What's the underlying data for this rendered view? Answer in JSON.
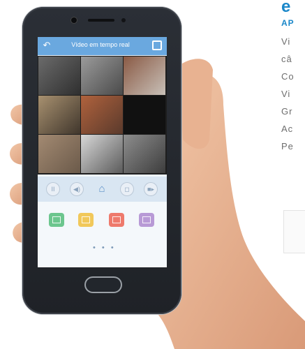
{
  "side_text": {
    "heading": "e",
    "subheading": "AP",
    "lines": [
      "Vi",
      "câ",
      "Co",
      "Vi",
      "Gr",
      "Ac",
      "Pe"
    ]
  },
  "app": {
    "title": "Vídeo em tempo real",
    "back_icon": "back-arrow-icon",
    "fullscreen_icon": "fullscreen-icon",
    "pager_dots": "• • •"
  },
  "controls": [
    {
      "name": "pause-icon",
      "glyph": "II"
    },
    {
      "name": "volume-icon",
      "glyph": "◀)"
    },
    {
      "name": "home-icon",
      "glyph": "⌂"
    },
    {
      "name": "snapshot-icon",
      "glyph": "◻"
    },
    {
      "name": "record-icon",
      "glyph": "■▸"
    }
  ],
  "layout_tiles": [
    {
      "name": "single-view-icon",
      "color": "#6cc68e"
    },
    {
      "name": "quad-view-icon",
      "color": "#f1c85a"
    },
    {
      "name": "nine-view-icon",
      "color": "#ee7a6c"
    },
    {
      "name": "sixteen-view-icon",
      "color": "#b89ad6"
    }
  ],
  "colors": {
    "accent": "#1a87c9",
    "appbar": "#6aa8df"
  }
}
